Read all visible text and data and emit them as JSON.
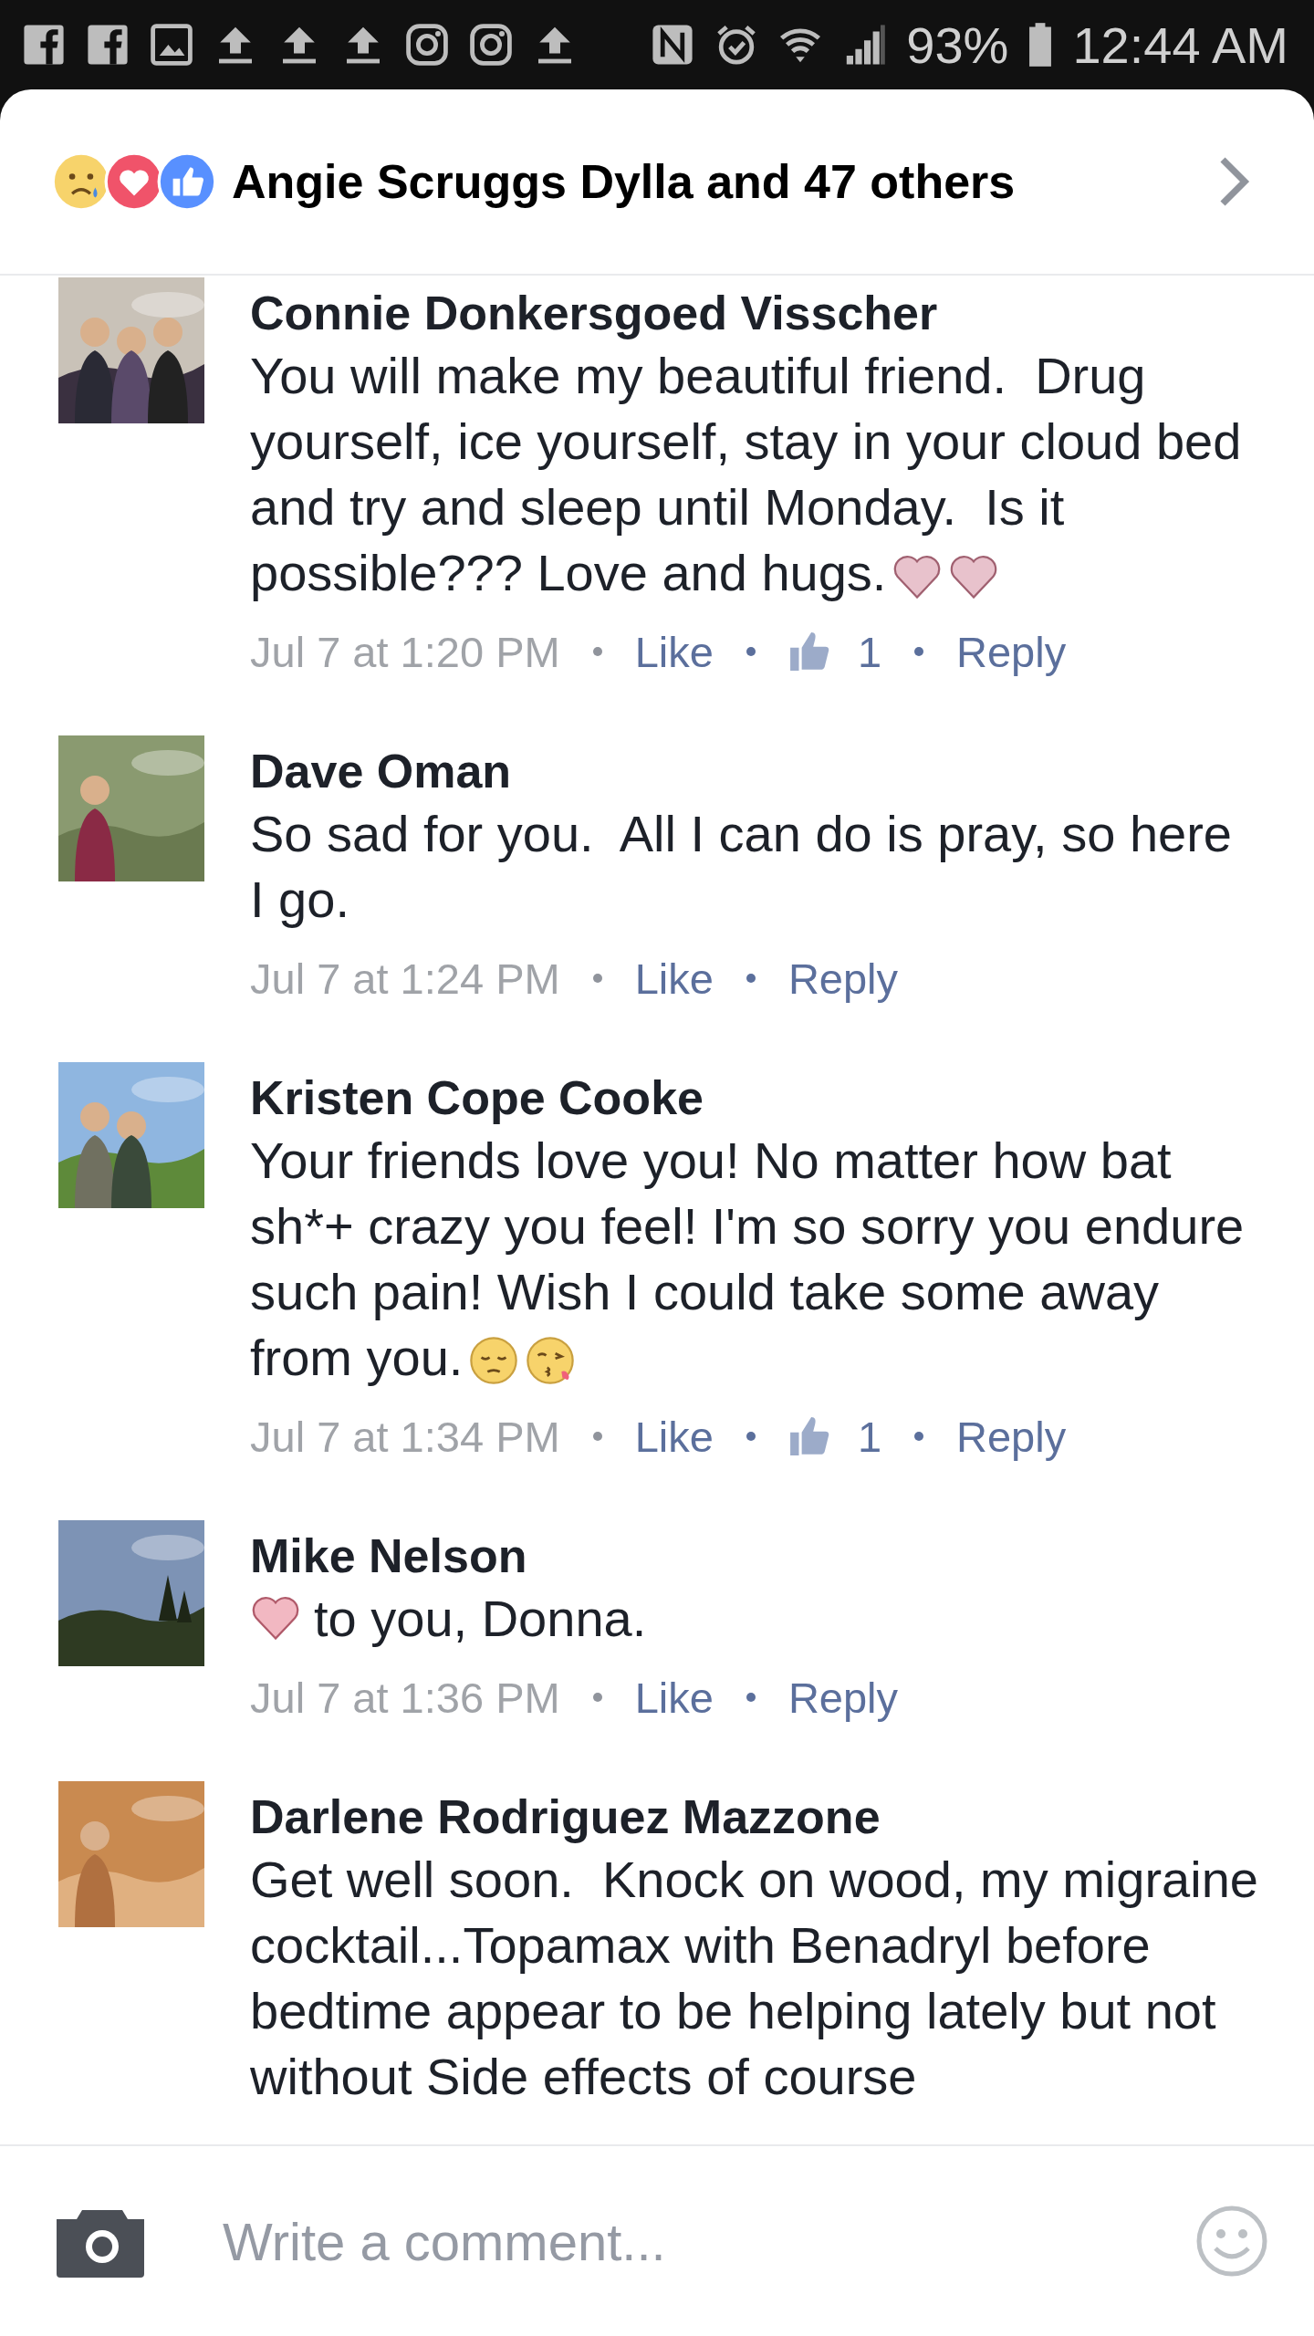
{
  "status_bar": {
    "battery": "93%",
    "time": "12:44 AM",
    "notification_icons": [
      {
        "kind": "facebook"
      },
      {
        "kind": "facebook"
      },
      {
        "kind": "gallery"
      },
      {
        "kind": "upload"
      },
      {
        "kind": "upload"
      },
      {
        "kind": "upload"
      },
      {
        "kind": "instagram"
      },
      {
        "kind": "instagram"
      },
      {
        "kind": "upload"
      }
    ]
  },
  "reactions": {
    "reaction_icons": [
      {
        "kind": "sad"
      },
      {
        "kind": "love"
      },
      {
        "kind": "like"
      }
    ],
    "summary": "Angie Scruggs Dylla and 47 others"
  },
  "comments": [
    {
      "author": "Connie Donkersgoed Visscher",
      "text": "You will make my beautiful friend.  Drug yourself, ice yourself, stay in your cloud bed and try and sleep until Monday.  Is it possible??? Love and hugs.",
      "trailing_emoji": [
        {
          "kind": "heart"
        },
        {
          "kind": "heart"
        }
      ],
      "time": "Jul 7 at 1:20 PM",
      "like": "Like",
      "likes": "1",
      "reply": "Reply"
    },
    {
      "author": "Dave Oman",
      "text": "So sad for you.  All I can do is pray, so here I go.",
      "time": "Jul 7 at 1:24 PM",
      "like": "Like",
      "reply": "Reply"
    },
    {
      "author": "Kristen Cope Cooke",
      "text": "Your friends love you! No matter how bat sh*+ crazy you feel! I'm so sorry you endure such pain! Wish I could take some away from you.",
      "trailing_emoji": [
        {
          "kind": "pensive"
        },
        {
          "kind": "kiss"
        }
      ],
      "time": "Jul 7 at 1:34 PM",
      "like": "Like",
      "likes": "1",
      "reply": "Reply"
    },
    {
      "author": "Mike Nelson",
      "text": "to you, Donna.",
      "leading_emoji": [
        {
          "kind": "heart"
        }
      ],
      "time": "Jul 7 at 1:36 PM",
      "like": "Like",
      "reply": "Reply"
    },
    {
      "author": "Darlene Rodriguez Mazzone",
      "text": "Get well soon.  Knock on wood, my migraine cocktail...Topamax with Benadryl before bedtime appear to be helping lately but not without Side effects of course"
    }
  ],
  "composer": {
    "placeholder": "Write a comment..."
  }
}
